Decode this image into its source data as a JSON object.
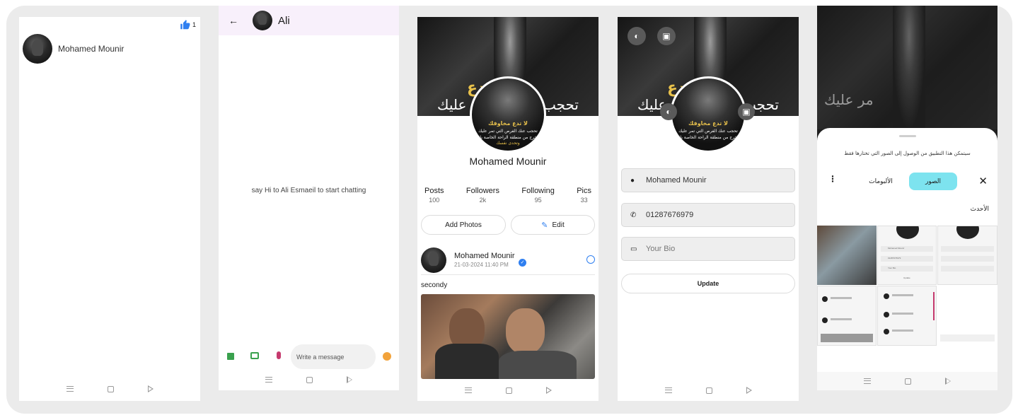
{
  "screen1": {
    "like_count": "1",
    "contact_name": "Mohamed Mounir",
    "like_icon": "thumbs-up-icon"
  },
  "screen2": {
    "title": "Ali",
    "empty_message": "say Hi to Ali Esmaeil to start chatting",
    "input_placeholder": "Write a message",
    "icons": [
      "back-arrow-icon",
      "gallery-icon",
      "camera-icon",
      "mic-icon",
      "emoji-icon"
    ]
  },
  "screen3": {
    "name": "Mohamed Mounir",
    "cover_text_yellow": "لا تدع",
    "cover_text_white_left": "مر عليك",
    "cover_text_white_right": "تحجب ع",
    "avatar_text_1": "لا تدع مخاوفك",
    "avatar_text_2": "تحجب عنك الفرص التي تمر عليك",
    "avatar_text_3": "اخرج من منطقة الراحة الخاصة بك",
    "avatar_text_4": "وتحدى نفسك",
    "stats": [
      {
        "label": "Posts",
        "value": "100"
      },
      {
        "label": "Followers",
        "value": "2k"
      },
      {
        "label": "Following",
        "value": "95"
      },
      {
        "label": "Pics",
        "value": "33"
      }
    ],
    "add_photos_label": "Add Photos",
    "edit_label": "Edit",
    "post": {
      "author": "Mohamed Mounir",
      "date": "21-03-2024 11:40 PM",
      "text": "secondy"
    }
  },
  "screen4": {
    "name_value": "Mohamed Mounir",
    "phone_value": "01287676979",
    "bio_placeholder": "Your Bio",
    "update_label": "Update"
  },
  "screen5": {
    "permission_text": "سيتمكن هذا التطبيق من الوصول إلى الصور التي تختارها فقط",
    "tab_photos": "الصور",
    "tab_albums": "الألبومات",
    "section_recent": "الأحدث",
    "close_icon": "close-icon",
    "mini_name": "Mohamed Mounir",
    "mini_phone": "01287676979",
    "mini_bio": "Your Bio",
    "mini_update": "Update"
  },
  "colors": {
    "like_blue": "#2f7ff0",
    "tab_active": "#7de3ef",
    "chat_header": "#f8f0fb",
    "verified_blue": "#2f7ff0"
  }
}
